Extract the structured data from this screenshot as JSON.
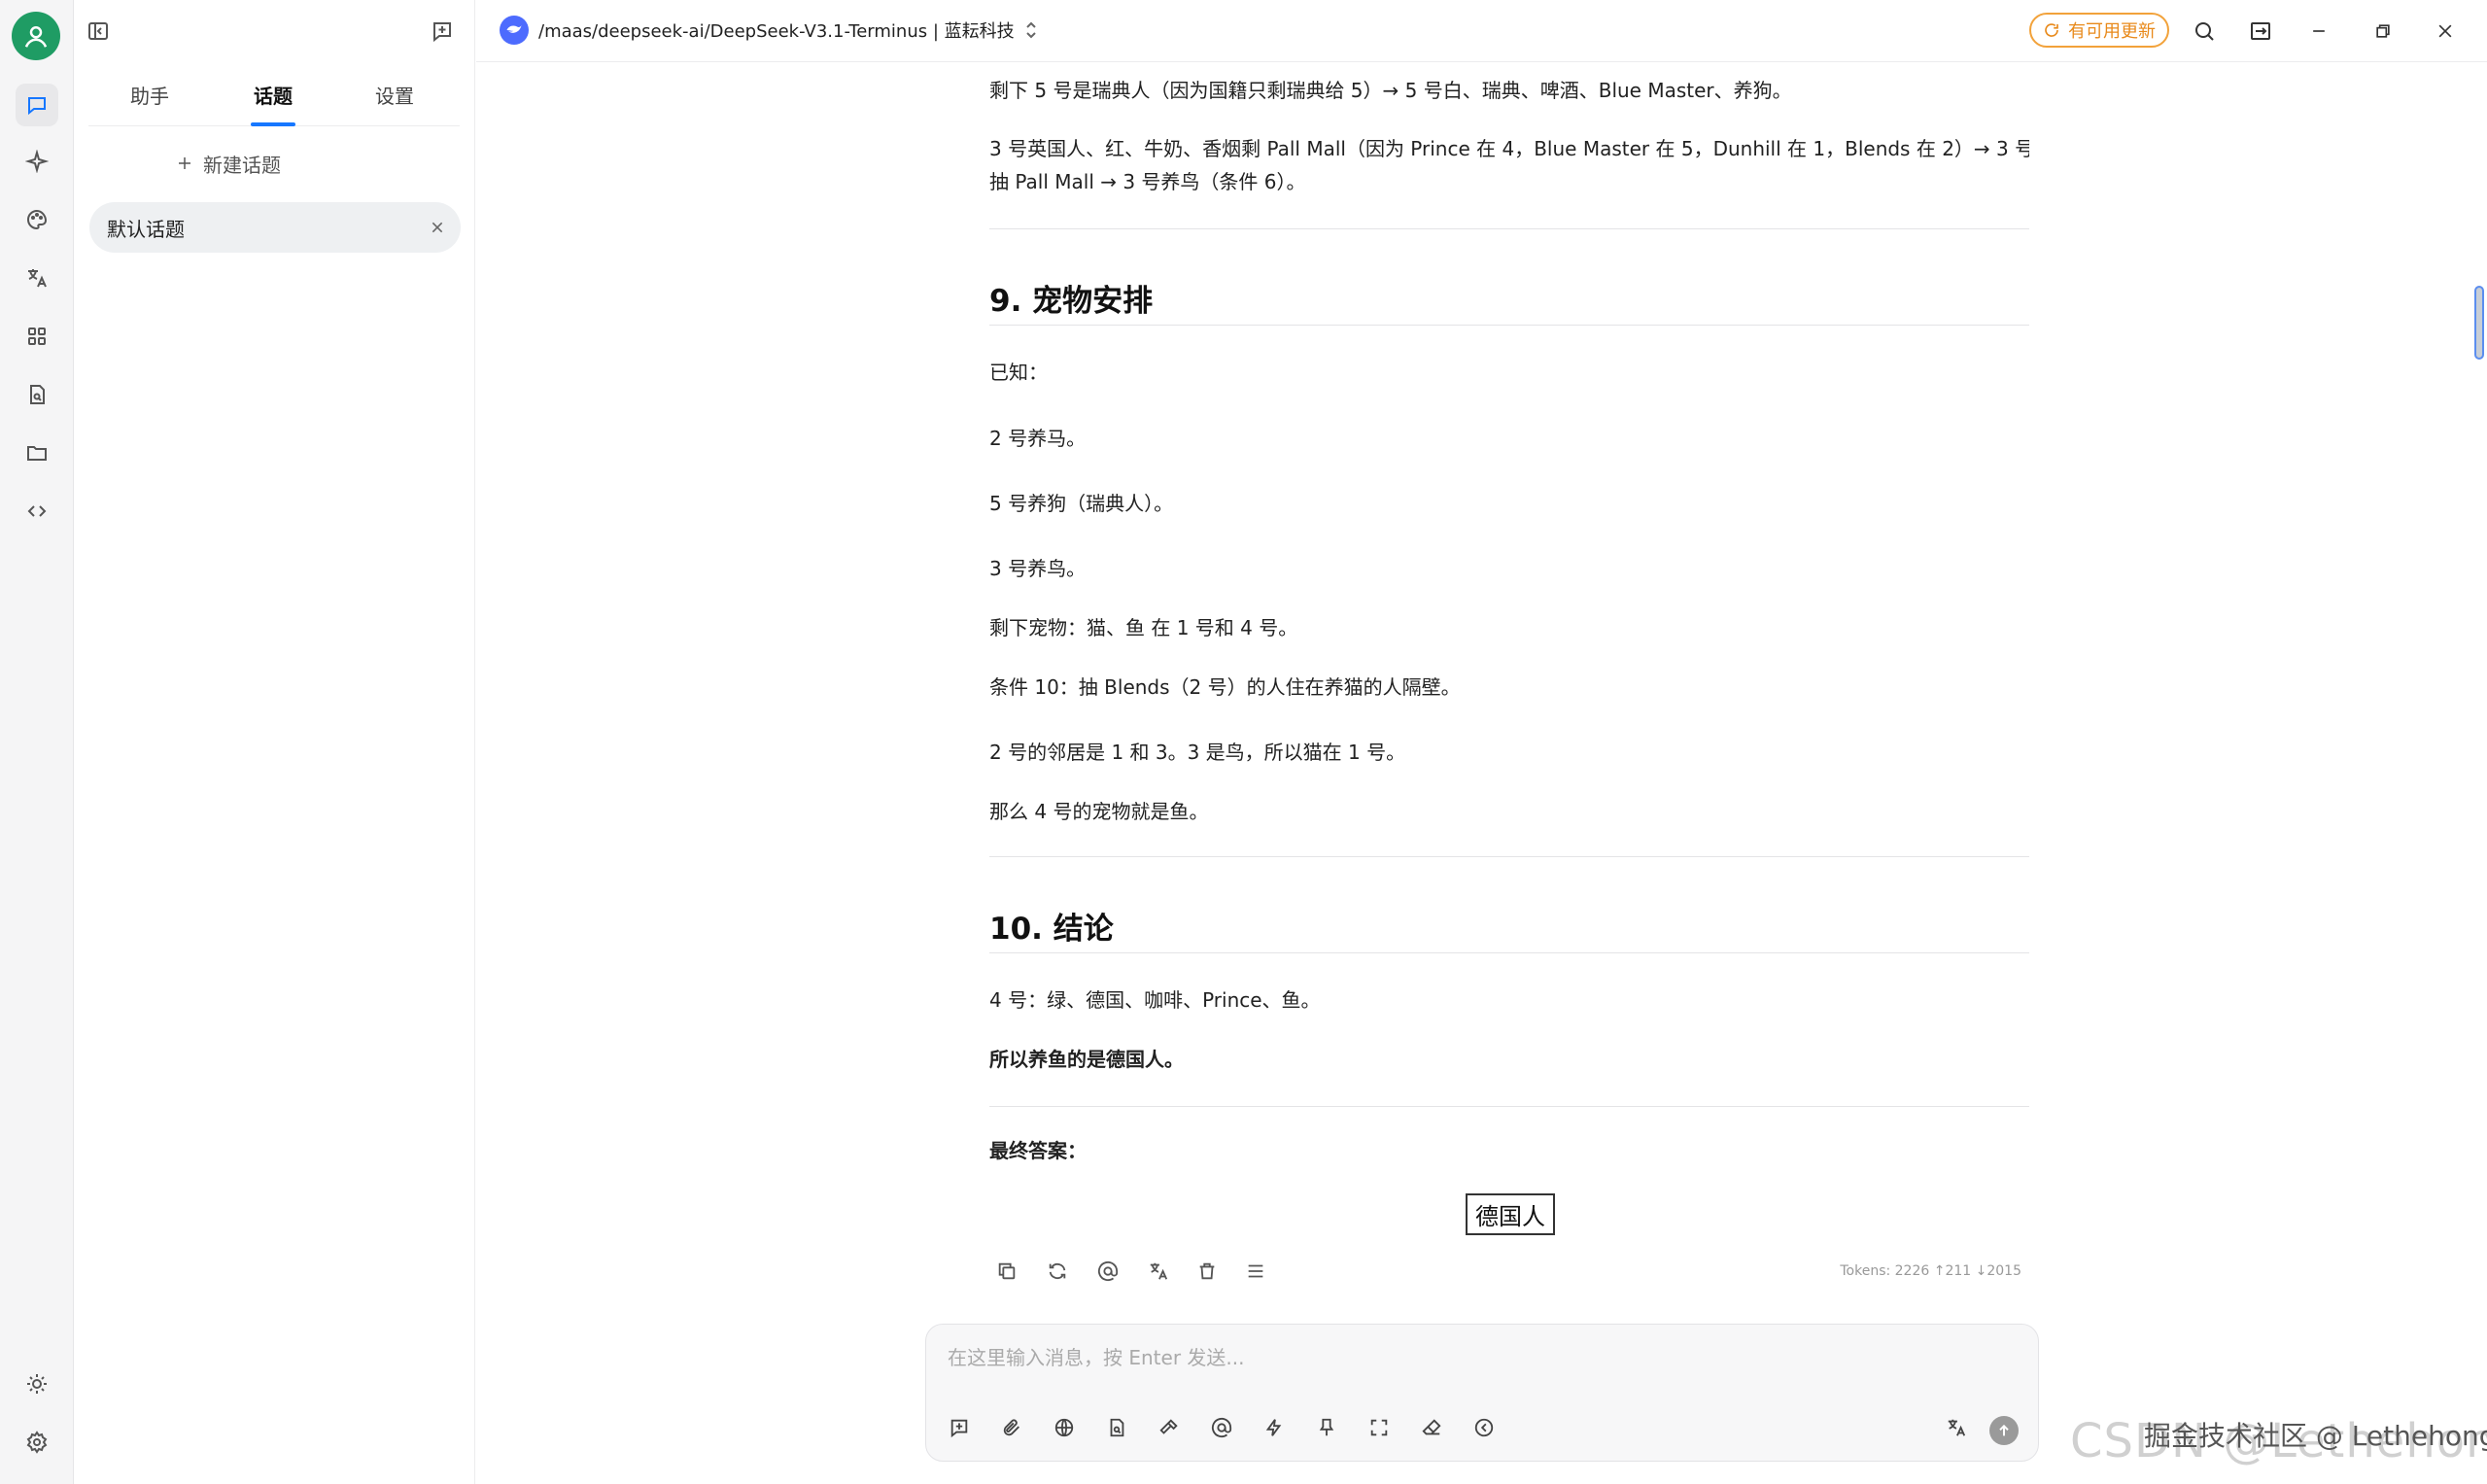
{
  "sidebar_tabs": [
    "助手",
    "话题",
    "设置"
  ],
  "new_topic_label": "新建话题",
  "topics": [
    "默认话题"
  ],
  "header": {
    "model_title": "/maas/deepseek-ai/DeepSeek-V3.1-Terminus | 蓝耘科技",
    "update_label": "有可用更新"
  },
  "message": {
    "line1": "剩下 5 号是瑞典人（因为国籍只剩瑞典给 5）→ 5 号白、瑞典、啤酒、Blue Master、养狗。",
    "line2a": "3 号英国人、红、牛奶、香烟剩 Pall Mall（因为 Prince 在 4，Blue Master 在 5，Dunhill 在 1，Blends 在 2）→ 3 号",
    "line2b": "抽 Pall Mall → 3 号养鸟（条件 6）。",
    "h9": "9. 宠物安排",
    "known": "已知：",
    "p1": "2 号养马。",
    "p2": "5 号养狗（瑞典人）。",
    "p3": "3 号养鸟。",
    "p4": "剩下宠物：猫、鱼 在 1 号和 4 号。",
    "p5": "条件 10：抽 Blends（2 号）的人住在养猫的人隔壁。",
    "p6": "2 号的邻居是 1 和 3。3 是鸟，所以猫在 1 号。",
    "p7": "那么 4 号的宠物就是鱼。",
    "h10": "10. 结论",
    "c1": "4 号：绿、德国、咖啡、Prince、鱼。",
    "c2": "所以养鱼的是德国人。",
    "final_label": "最终答案：",
    "answer": "德国人"
  },
  "tokens_text": "Tokens: 2226 ↑211 ↓2015",
  "input_placeholder": "在这里输入消息，按 Enter 发送...",
  "watermark": {
    "csdn": "CSDN @Lethehong",
    "juejin": "掘金技术社区 @ Lethehong"
  },
  "colors": {
    "accent": "#1677ff",
    "avatar": "#1f9c64",
    "update": "#e8891a",
    "deepseek": "#4d6bfe"
  }
}
